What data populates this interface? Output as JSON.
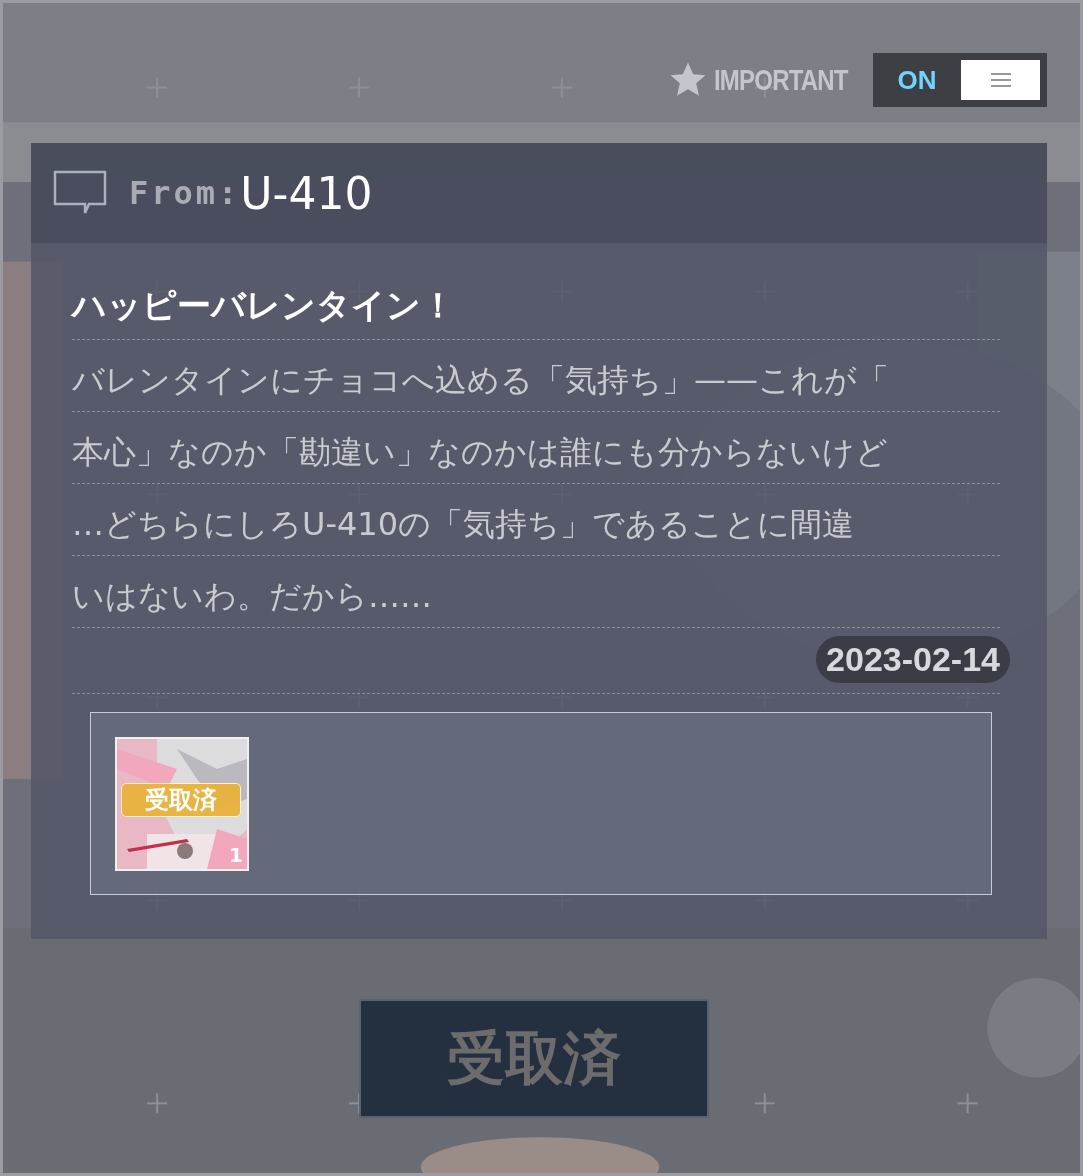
{
  "important": {
    "label": "IMPORTANT",
    "toggle": {
      "label": "ON",
      "on": true
    }
  },
  "mail": {
    "from_label": "From:",
    "sender": "U-410",
    "title": "ハッピーバレンタイン！",
    "body_lines": [
      "バレンタインにチョコへ込める「気持ち」——これが「",
      "本心」なのか「勘違い」なのかは誰にも分からないけど",
      "…どちらにしろU-410の「気持ち」であることに間違",
      "いはないわ。だから……"
    ],
    "date": "2023-02-14",
    "rewards": [
      {
        "kind": "picture",
        "badge": "受取済",
        "count": "1"
      }
    ]
  },
  "claim_button": {
    "label": "受取済",
    "disabled": true
  }
}
